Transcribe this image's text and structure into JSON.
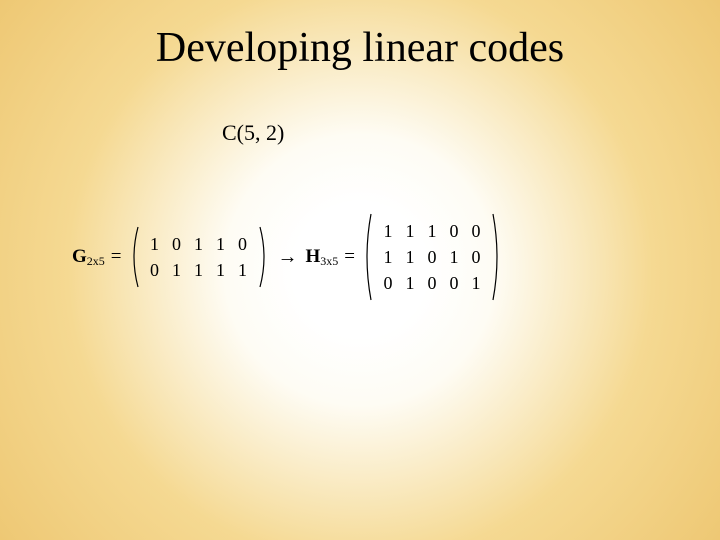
{
  "title": "Developing linear codes",
  "code_label": "C(5, 2)",
  "equation": {
    "g_name": "G",
    "g_sub": "2x5",
    "eq": "=",
    "arrow": "→",
    "h_name": "H",
    "h_sub": "3x5"
  },
  "g_matrix": {
    "rows": 2,
    "cols": 5,
    "values": [
      [
        "1",
        "0",
        "1",
        "1",
        "0"
      ],
      [
        "0",
        "1",
        "1",
        "1",
        "1"
      ]
    ]
  },
  "h_matrix": {
    "rows": 3,
    "cols": 5,
    "values": [
      [
        "1",
        "1",
        "1",
        "0",
        "0"
      ],
      [
        "1",
        "1",
        "0",
        "1",
        "0"
      ],
      [
        "0",
        "1",
        "0",
        "0",
        "1"
      ]
    ]
  }
}
